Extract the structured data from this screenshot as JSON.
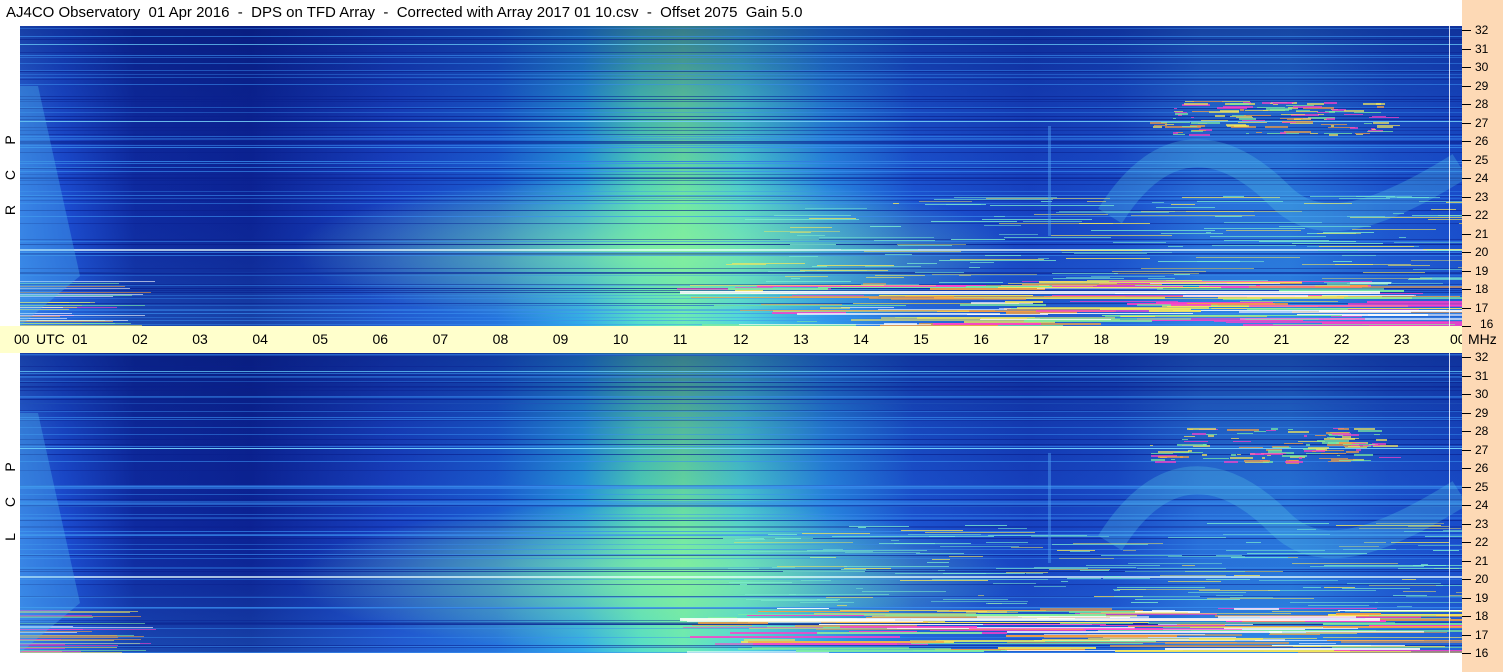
{
  "title": "AJ4CO Observatory  01 Apr 2016  -  DPS on TFD Array  -  Corrected with Array 2017 01 10.csv  -  Offset 2075  Gain 5.0",
  "panels": {
    "top": {
      "letters": [
        "R",
        "C",
        "P"
      ]
    },
    "bottom": {
      "letters": [
        "L",
        "C",
        "P"
      ]
    }
  },
  "time_axis": {
    "labels": [
      "00",
      "UTC",
      "01",
      "02",
      "03",
      "04",
      "05",
      "06",
      "07",
      "08",
      "09",
      "10",
      "11",
      "12",
      "13",
      "14",
      "15",
      "16",
      "17",
      "18",
      "19",
      "20",
      "21",
      "22",
      "23",
      "00",
      "MHz"
    ]
  },
  "freq_axis": {
    "labels": [
      "32",
      "31",
      "30",
      "29",
      "28",
      "27",
      "26",
      "25",
      "24",
      "23",
      "22",
      "21",
      "20",
      "19",
      "18",
      "17",
      "16"
    ]
  },
  "colors": {
    "background_deep": "#0a1f8c",
    "background_mid": "#1a4fd8",
    "noise_cyan": "#39c7e8",
    "noise_green": "#7ef0a0",
    "storm_yellow": "#f5e85a",
    "storm_magenta": "#ff3fc8",
    "utc_bar": "#ffffcc",
    "freq_bar": "#fdd9b5"
  },
  "chart_data": [
    {
      "type": "heatmap",
      "title": "AJ4CO Observatory  01 Apr 2016  -  DPS on TFD Array  -  Corrected with Array 2017 01 10.csv  -  Offset 2075  Gain 5.0",
      "polarization": "RCP",
      "xlabel": "UTC",
      "ylabel": "MHz",
      "xlim": [
        0,
        24
      ],
      "ylim": [
        16,
        32
      ],
      "x_ticks": [
        "00",
        "01",
        "02",
        "03",
        "04",
        "05",
        "06",
        "07",
        "08",
        "09",
        "10",
        "11",
        "12",
        "13",
        "14",
        "15",
        "16",
        "17",
        "18",
        "19",
        "20",
        "21",
        "22",
        "23",
        "00"
      ],
      "y_ticks": [
        32,
        31,
        30,
        29,
        28,
        27,
        26,
        25,
        24,
        23,
        22,
        21,
        20,
        19,
        18,
        17,
        16
      ],
      "colormap": "jet"
    },
    {
      "type": "heatmap",
      "polarization": "LCP",
      "xlabel": "UTC",
      "ylabel": "MHz",
      "xlim": [
        0,
        24
      ],
      "ylim": [
        16,
        32
      ],
      "x_ticks": [
        "00",
        "01",
        "02",
        "03",
        "04",
        "05",
        "06",
        "07",
        "08",
        "09",
        "10",
        "11",
        "12",
        "13",
        "14",
        "15",
        "16",
        "17",
        "18",
        "19",
        "20",
        "21",
        "22",
        "23",
        "00"
      ],
      "y_ticks": [
        32,
        31,
        30,
        29,
        28,
        27,
        26,
        25,
        24,
        23,
        22,
        21,
        20,
        19,
        18,
        17,
        16
      ],
      "colormap": "jet"
    }
  ]
}
